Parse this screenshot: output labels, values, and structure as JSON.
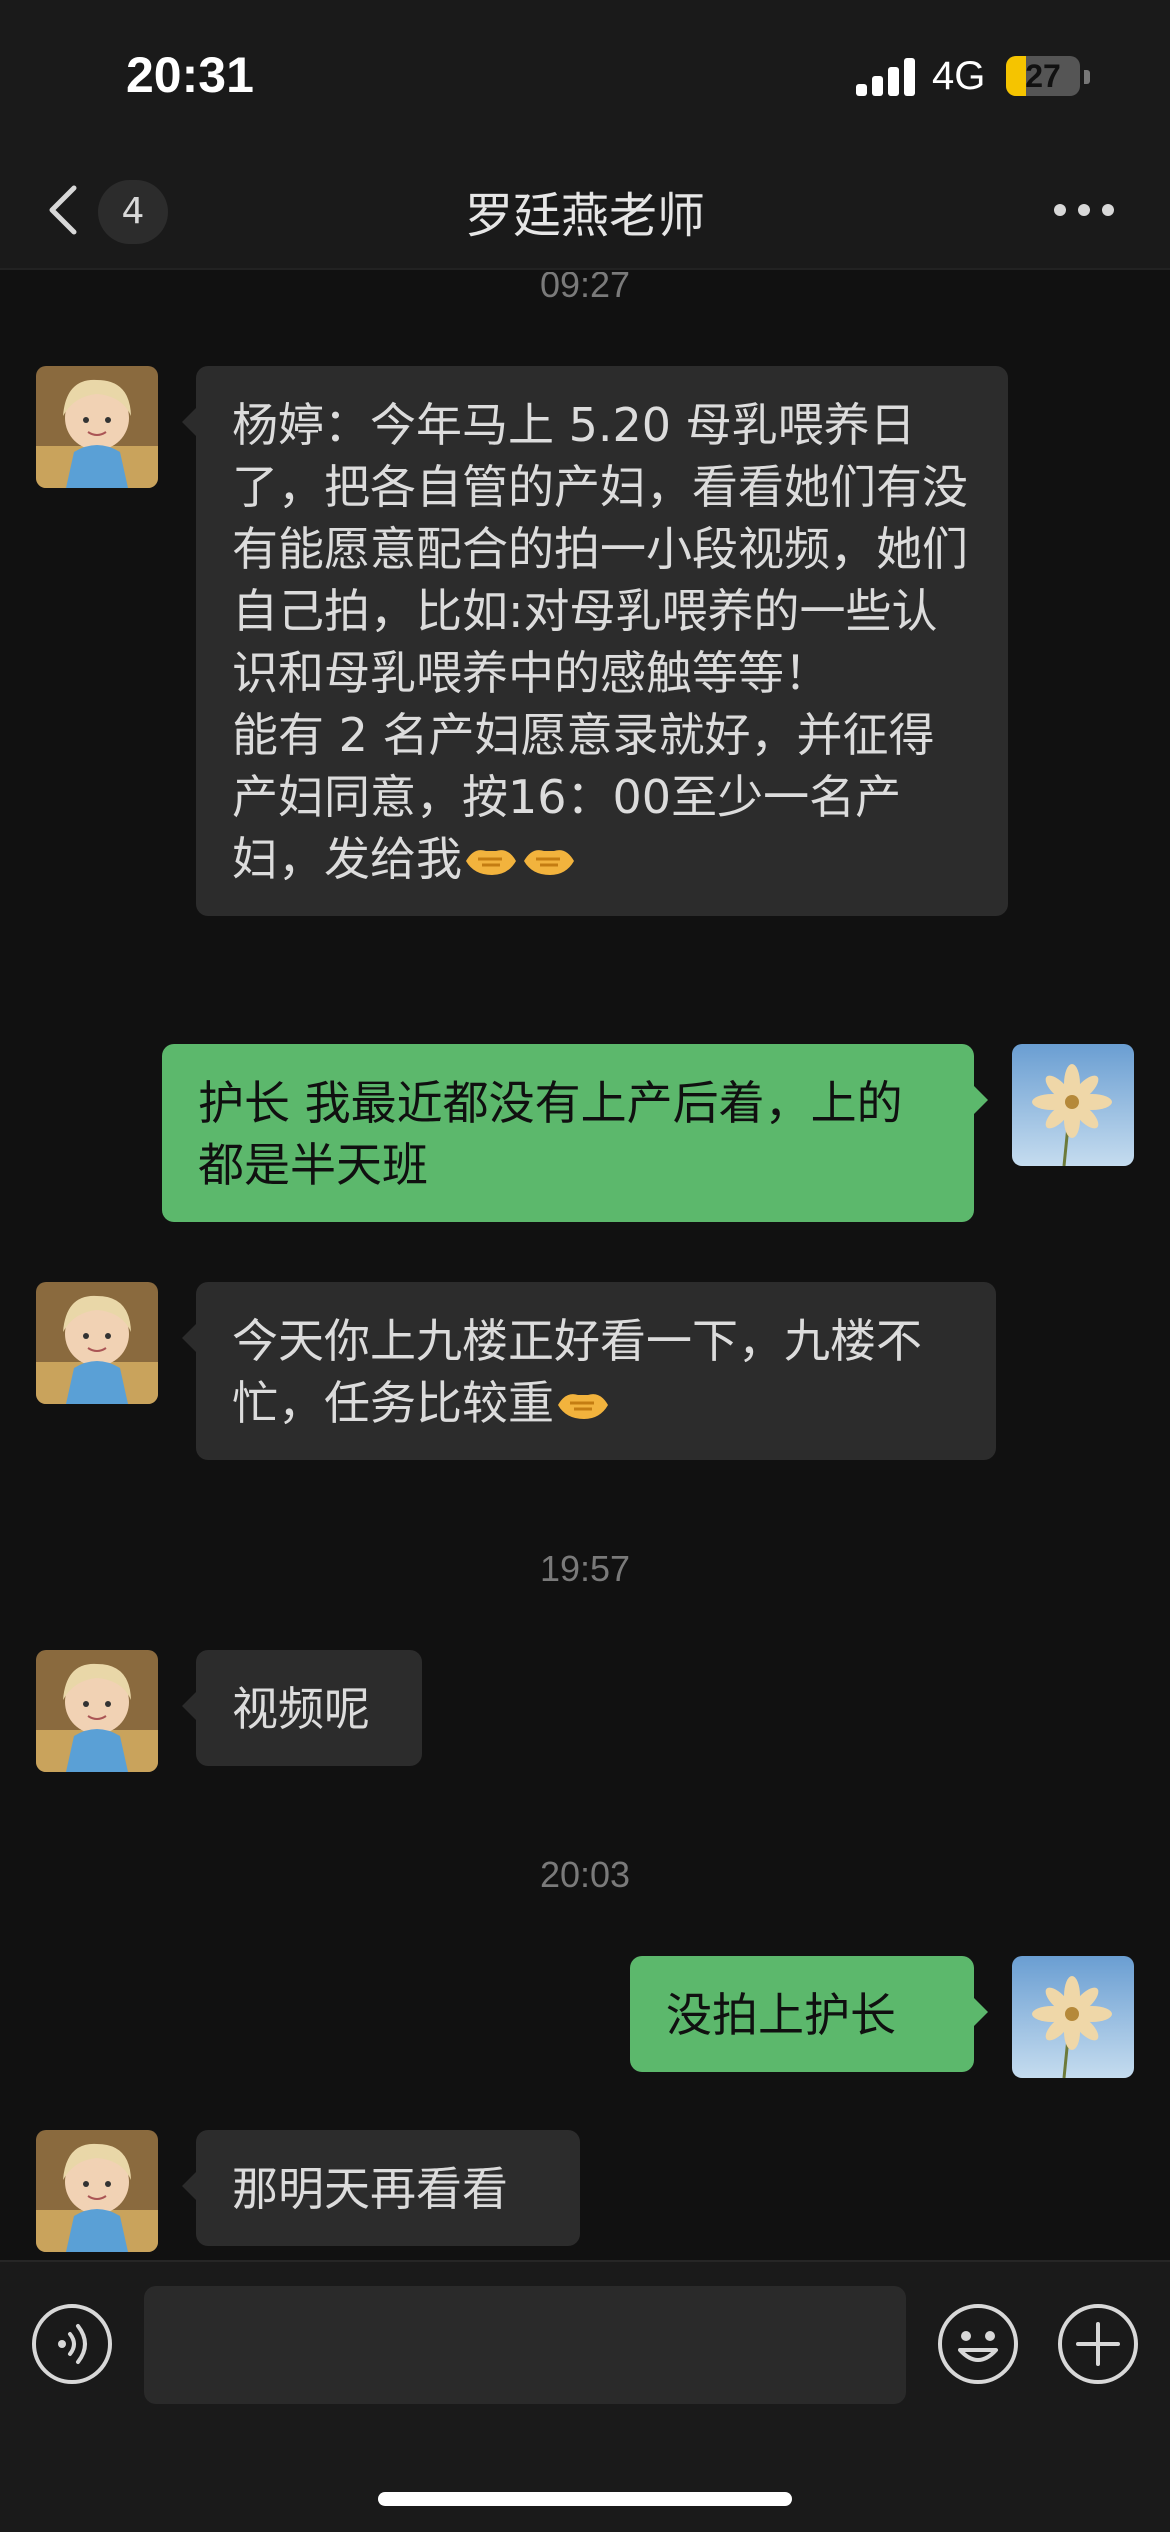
{
  "status_bar": {
    "time": "20:31",
    "network": "4G",
    "battery": "27",
    "battery_level": 0.27
  },
  "nav": {
    "back_icon": "chevron-left-icon",
    "unread_count": "4",
    "title": "罗廷燕老师",
    "more_icon": "more-horizontal-icon"
  },
  "messages": {
    "ts1": "09:27",
    "m1": {
      "sender": "contact",
      "text": "杨婷：今年马上 5.20 母乳喂养日了，把各自管的产妇，看看她们有没有能愿意配合的拍一小段视频，她们自己拍，比如:对母乳喂养的一些认识和母乳喂养中的感触等等！\n能有 2 名产妇愿意录就好，并征得产妇同意，按16：00至少一名产妇，发给我",
      "emoji": "handshake-emoji ×2"
    },
    "m2": {
      "sender": "me",
      "text": "护长 我最近都没有上产后着，上的都是半天班"
    },
    "m3": {
      "sender": "contact",
      "text": "今天你上九楼正好看一下，九楼不忙，任务比较重",
      "emoji": "handshake-emoji"
    },
    "ts2": "19:57",
    "m4": {
      "sender": "contact",
      "text": "视频呢"
    },
    "ts3": "20:03",
    "m5": {
      "sender": "me",
      "text": "没拍上护长"
    },
    "m6": {
      "sender": "contact",
      "text": "那明天再看看"
    }
  },
  "input_bar": {
    "voice_icon": "voice-icon",
    "input_value": "",
    "emoji_icon": "smiley-icon",
    "plus_icon": "plus-circle-icon"
  },
  "colors": {
    "background": "#111111",
    "bubble_in": "#2c2c2c",
    "bubble_out": "#5cb86c",
    "battery_fill": "#f5c400"
  }
}
